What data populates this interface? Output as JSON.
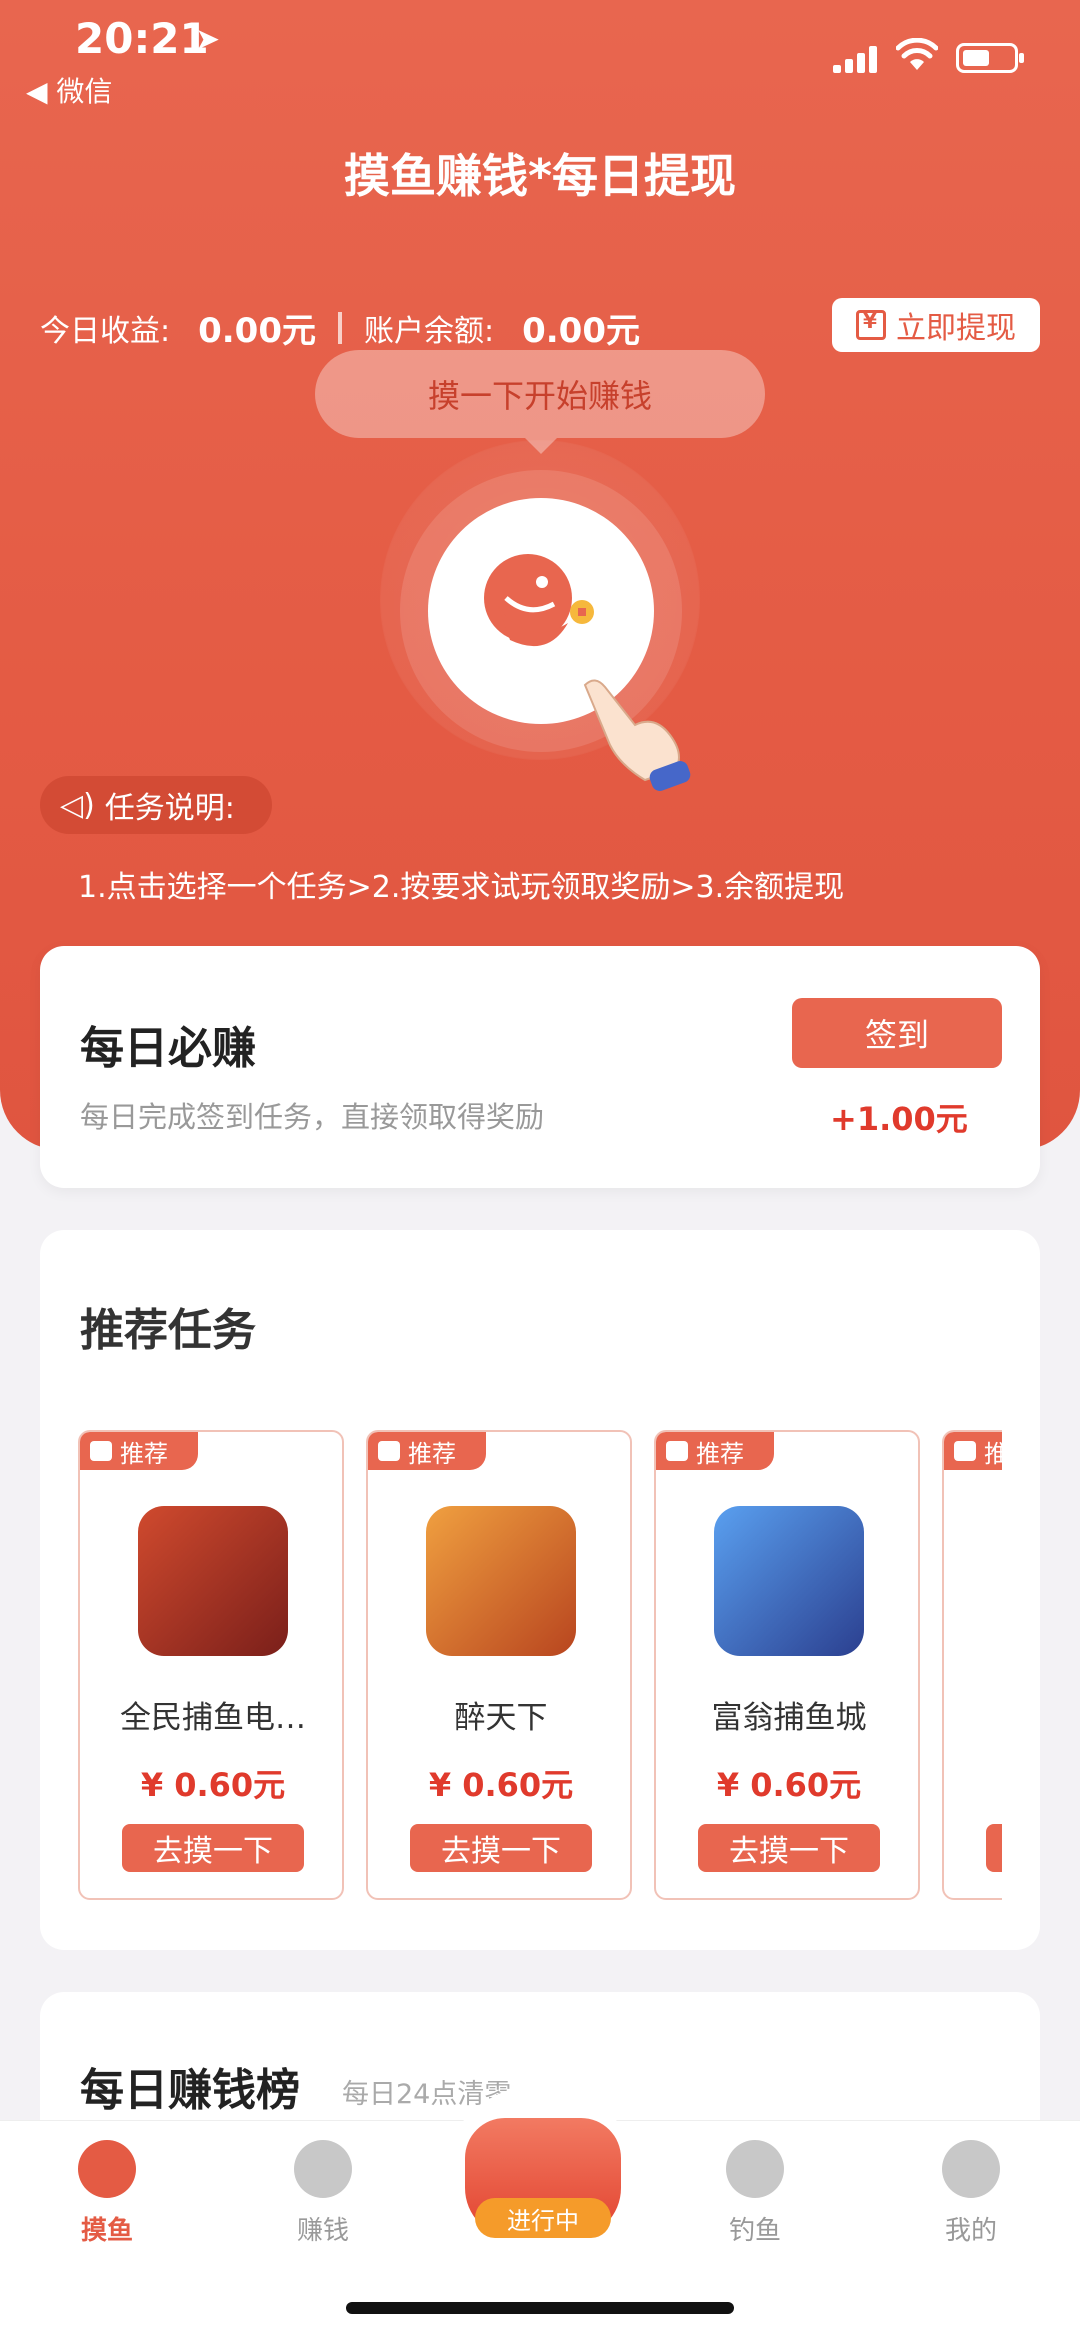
{
  "status_bar": {
    "time": "20:21",
    "back_app": "◀ 微信"
  },
  "header": {
    "title": "摸鱼赚钱*每日提现"
  },
  "earnings": {
    "today_label": "今日收益:",
    "today_value": "0.00元",
    "balance_label": "账户余额:",
    "balance_value": "0.00元",
    "withdraw_label": "立即提现"
  },
  "hero": {
    "bubble_text": "摸一下开始赚钱"
  },
  "task_info": {
    "tag": "任务说明:",
    "steps": "1.点击选择一个任务>2.按要求试玩领取奖励>3.余额提现"
  },
  "daily": {
    "title": "每日必赚",
    "subtitle": "每日完成签到任务，直接领取得奖励",
    "button": "签到",
    "reward": "+1.00元"
  },
  "recommended": {
    "title": "推荐任务",
    "tasks": [
      {
        "badge": "推荐",
        "name": "全民捕鱼电…",
        "price": "¥ 0.60元",
        "button": "去摸一下",
        "icon_color": "#c33a2a"
      },
      {
        "badge": "推荐",
        "name": "醉天下",
        "price": "¥ 0.60元",
        "button": "去摸一下",
        "icon_color": "#d9782a"
      },
      {
        "badge": "推荐",
        "name": "富翁捕鱼城",
        "price": "¥ 0.60元",
        "button": "去摸一下",
        "icon_color": "#3a6fd1"
      },
      {
        "badge": "推",
        "name": "",
        "price": "",
        "button": "",
        "icon_color": "#3a5fa8"
      }
    ]
  },
  "ranking": {
    "title": "每日赚钱榜",
    "subtitle": "每日24点清零"
  },
  "tabbar": {
    "tabs": [
      {
        "label": "摸鱼",
        "active": true
      },
      {
        "label": "赚钱",
        "active": false
      },
      {
        "label": "进行中",
        "active": false
      },
      {
        "label": "钓鱼",
        "active": false
      },
      {
        "label": "我的",
        "active": false
      }
    ]
  },
  "colors": {
    "brand": "#e45b44",
    "accent_red": "#e03a2c",
    "badge_orange": "#f59b2a"
  }
}
